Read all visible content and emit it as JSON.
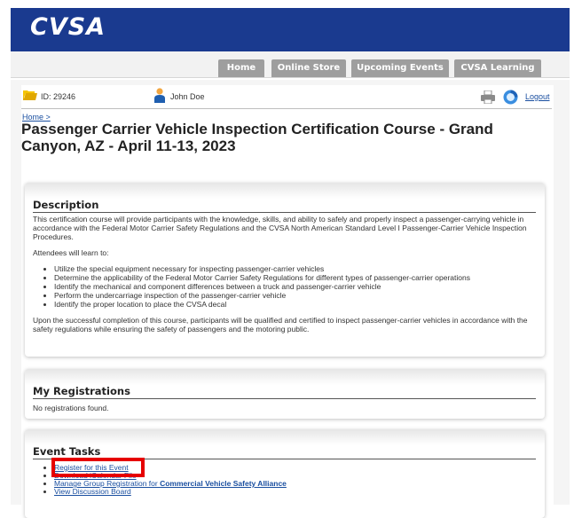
{
  "brand": {
    "logo_text": "CVSA",
    "banner_color": "#1a3a8f"
  },
  "nav": {
    "tabs": [
      "Home",
      "Online Store",
      "Upcoming Events",
      "CVSA Learning"
    ]
  },
  "user_bar": {
    "id_label": "ID: 29246",
    "user_name": "John Doe",
    "logout_label": "Logout",
    "icons": [
      "folder-icon",
      "user-icon",
      "printer-icon",
      "help-icon"
    ]
  },
  "breadcrumb": {
    "home": "Home >"
  },
  "page": {
    "title": "Passenger Carrier Vehicle Inspection Certification Course - Grand Canyon, AZ - April 11-13, 2023"
  },
  "description": {
    "heading": "Description",
    "intro": "This certification course will provide participants with the knowledge, skills, and ability to safely and properly inspect a passenger-carrying vehicle in accordance with the Federal Motor Carrier Safety Regulations and the CVSA North American Standard Level I Passenger-Carrier Vehicle Inspection Procedures.",
    "attendees_intro": "Attendees will learn to:",
    "objectives": [
      "Utilize the special equipment necessary for inspecting passenger-carrier vehicles",
      "Determine the applicability of the Federal Motor Carrier Safety Regulations for different types of passenger-carrier operations",
      "Identify the mechanical and component differences between a truck and passenger-carrier vehicle",
      "Perform the undercarriage inspection of the passenger-carrier vehicle",
      "Identify the proper location to place the CVSA decal"
    ],
    "outro": "Upon the successful completion of this course, participants will be qualified and certified to inspect passenger-carrier vehicles in accordance with the safety regulations while ensuring the safety of passengers and the motoring public."
  },
  "registrations": {
    "heading": "My Registrations",
    "empty_text": "No registrations found."
  },
  "event_tasks": {
    "heading": "Event Tasks",
    "register": "Register for this Event",
    "download": "Download iCalendar File",
    "group_prefix": "Manage Group Registration for ",
    "group_bold": "Commercial Vehicle Safety Alliance",
    "discussion": "View Discussion Board",
    "highlight_color": "#e60000"
  }
}
